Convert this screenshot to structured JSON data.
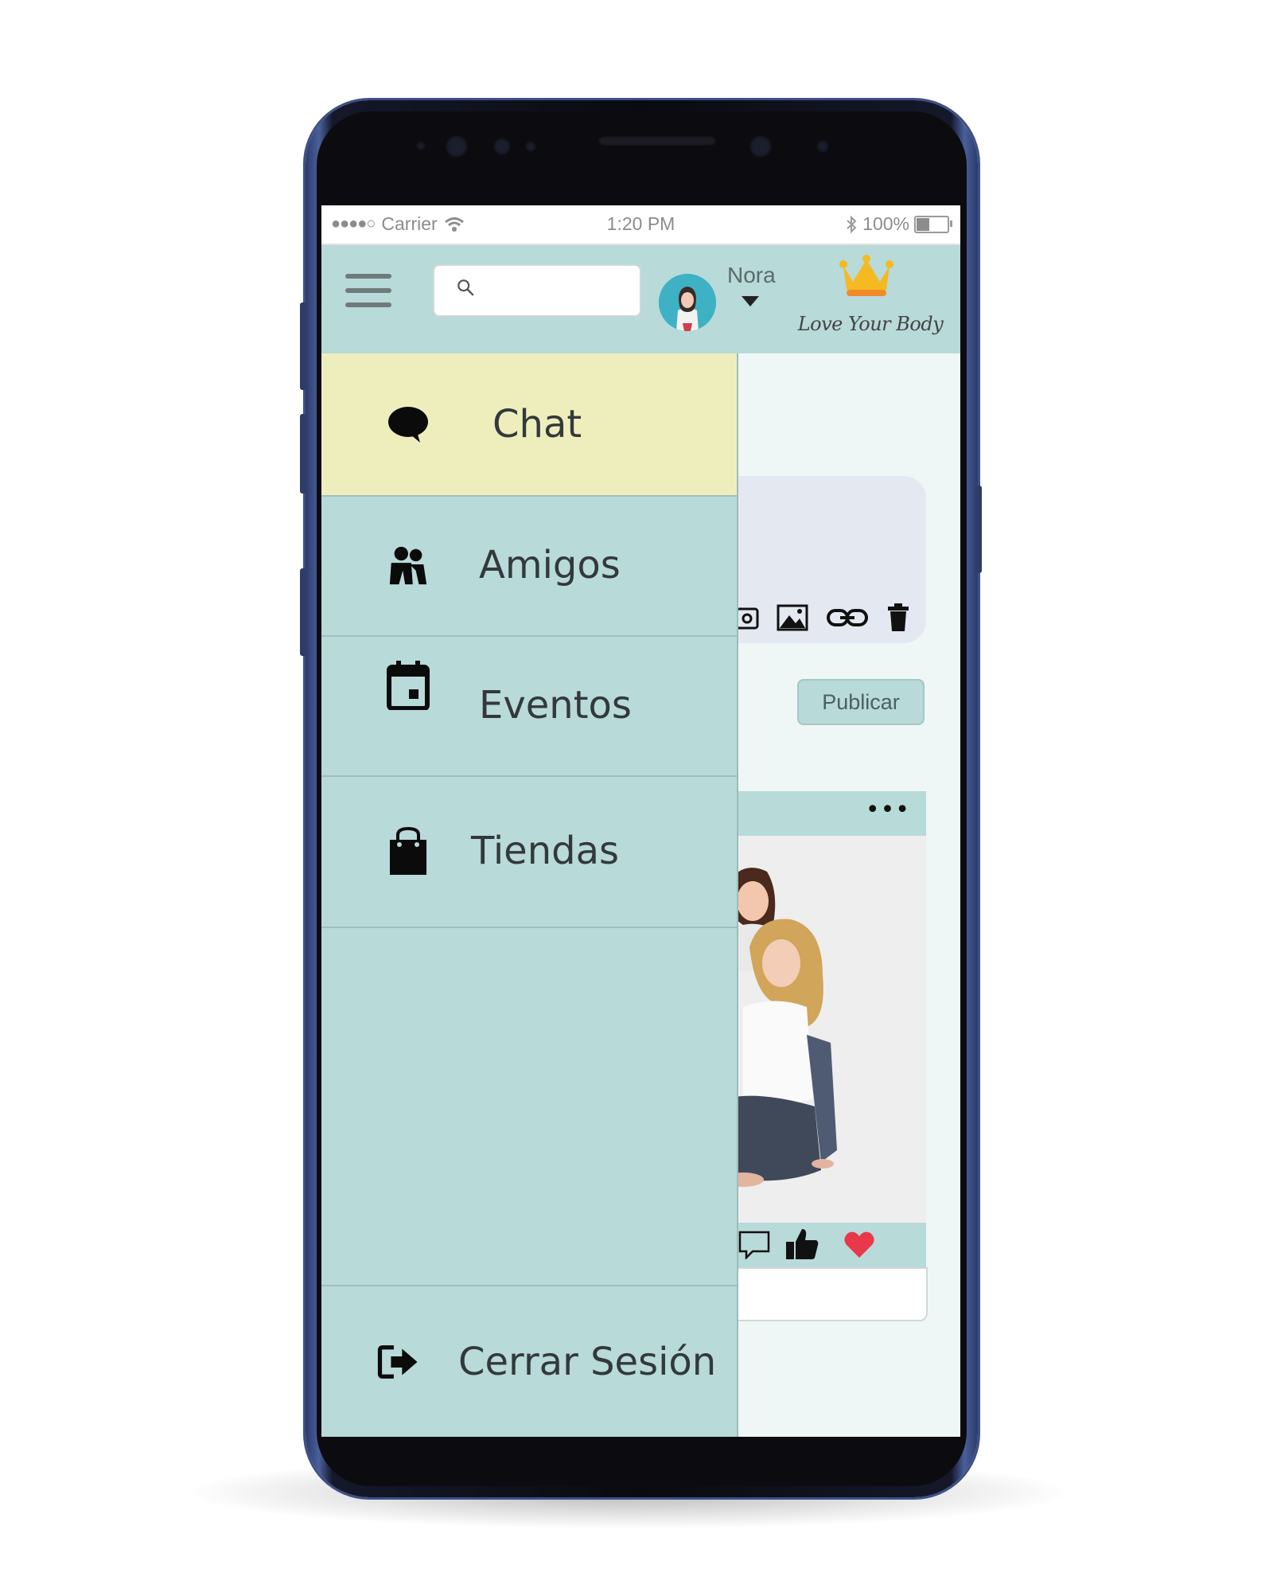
{
  "status_bar": {
    "carrier": "Carrier",
    "time": "1:20 PM",
    "battery": "100%"
  },
  "header": {
    "user_name": "Nora",
    "brand": "Love Your Body",
    "search": {
      "placeholder": ""
    }
  },
  "drawer": {
    "items": [
      {
        "label": "Chat",
        "icon": "chat-bubble-icon",
        "active": true
      },
      {
        "label": "Amigos",
        "icon": "friends-icon",
        "active": false
      },
      {
        "label": "Eventos",
        "icon": "calendar-icon",
        "active": false
      },
      {
        "label": "Tiendas",
        "icon": "shopping-bag-icon",
        "active": false
      }
    ],
    "logout_label": "Cerrar Sesión"
  },
  "feed": {
    "publish_label": "Publicar",
    "more_label": "•••"
  },
  "colors": {
    "header_bg": "#b8dad9",
    "active_item_bg": "#eeeebc",
    "heart": "#e8384a"
  }
}
